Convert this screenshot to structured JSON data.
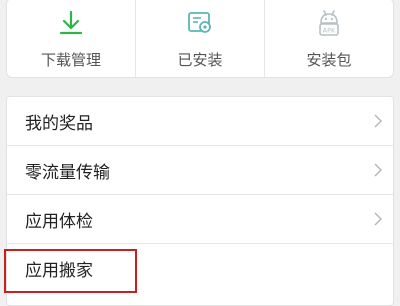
{
  "shortcuts": [
    {
      "icon": "download-icon",
      "label": "下载管理"
    },
    {
      "icon": "installed-icon",
      "label": "已安装"
    },
    {
      "icon": "apk-package-icon",
      "label": "安装包",
      "icon_text": "APK"
    }
  ],
  "menu": [
    {
      "label": "我的奖品",
      "has_arrow": true
    },
    {
      "label": "零流量传输",
      "has_arrow": true
    },
    {
      "label": "应用体检",
      "has_arrow": true
    },
    {
      "label": "应用搬家",
      "has_arrow": false
    }
  ],
  "colors": {
    "accent_green": "#2fb44a",
    "icon_teal": "#5ab7b3",
    "icon_gray": "#b9c0c4",
    "highlight_red": "#c62020"
  }
}
